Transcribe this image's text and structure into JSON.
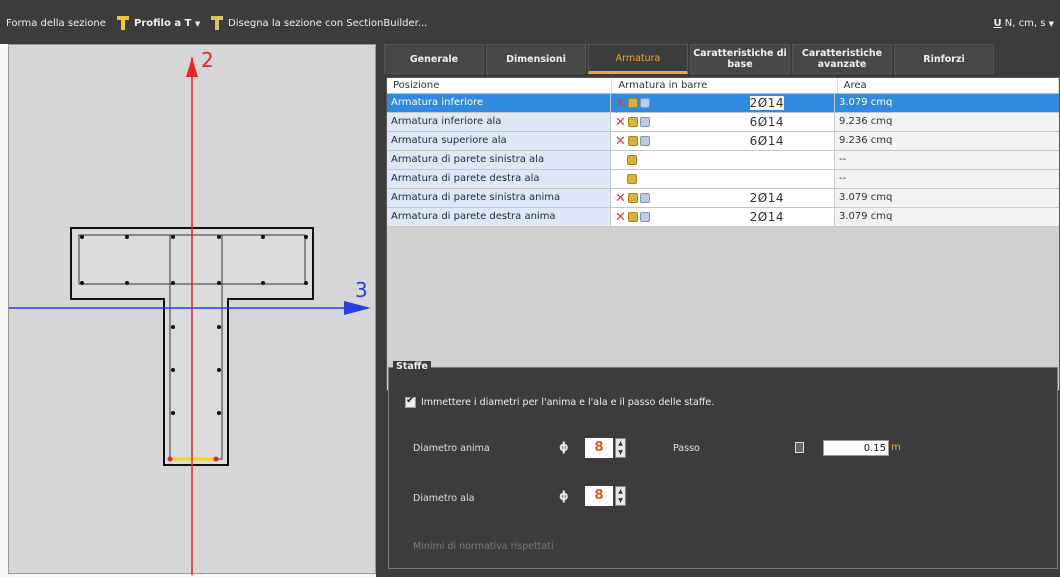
{
  "toolbar": {
    "section_shape_label": "Forma della sezione",
    "profile_label": "Profilo a T",
    "draw_label": "Disegna la sezione con SectionBuilder...",
    "units_icon": "U",
    "units_label": "N, cm, s"
  },
  "drawing": {
    "axis_vertical": "2",
    "axis_horizontal": "3"
  },
  "tabs": [
    {
      "label": "Generale",
      "active": false
    },
    {
      "label": "Dimensioni",
      "active": false
    },
    {
      "label": "Armatura",
      "active": true
    },
    {
      "label": "Caratteristiche di base",
      "active": false
    },
    {
      "label": "Caratteristiche avanzate",
      "active": false
    },
    {
      "label": "Rinforzi",
      "active": false
    }
  ],
  "table": {
    "headers": [
      "Posizione",
      "Armatura in barre",
      "Area"
    ],
    "rows": [
      {
        "position": "Armatura inferiore",
        "bars": "2Ø14",
        "area": "3.079 cmq",
        "selected": true,
        "icons": "full"
      },
      {
        "position": "Armatura inferiore ala",
        "bars": "6Ø14",
        "area": "9.236 cmq",
        "selected": false,
        "icons": "full"
      },
      {
        "position": "Armatura superiore ala",
        "bars": "6Ø14",
        "area": "9.236 cmq",
        "selected": false,
        "icons": "full"
      },
      {
        "position": "Armatura di parete sinistra ala",
        "bars": "",
        "area": "--",
        "selected": false,
        "icons": "edit"
      },
      {
        "position": "Armatura di parete destra ala",
        "bars": "",
        "area": "--",
        "selected": false,
        "icons": "edit"
      },
      {
        "position": "Armatura di parete sinistra anima",
        "bars": "2Ø14",
        "area": "3.079 cmq",
        "selected": false,
        "icons": "full"
      },
      {
        "position": "Armatura di parete destra anima",
        "bars": "2Ø14",
        "area": "3.079 cmq",
        "selected": false,
        "icons": "full"
      }
    ]
  },
  "stirrups": {
    "title": "Staffe",
    "checkbox_label": "Immettere i diametri per l'anima e l'ala e il passo delle staffe.",
    "checkbox_checked": true,
    "web_diameter_label": "Diametro anima",
    "web_diameter_value": "8",
    "pitch_label": "Passo",
    "pitch_value": "0.15",
    "pitch_unit": "m",
    "flange_diameter_label": "Diametro ala",
    "flange_diameter_value": "8",
    "phi_symbol": "ϕ",
    "note": "Minimi di normativa rispettati"
  },
  "colors": {
    "accent": "#f2a830",
    "selection": "#2f8ae0",
    "axis_red": "#e8272a",
    "axis_blue": "#2a3fe0"
  }
}
